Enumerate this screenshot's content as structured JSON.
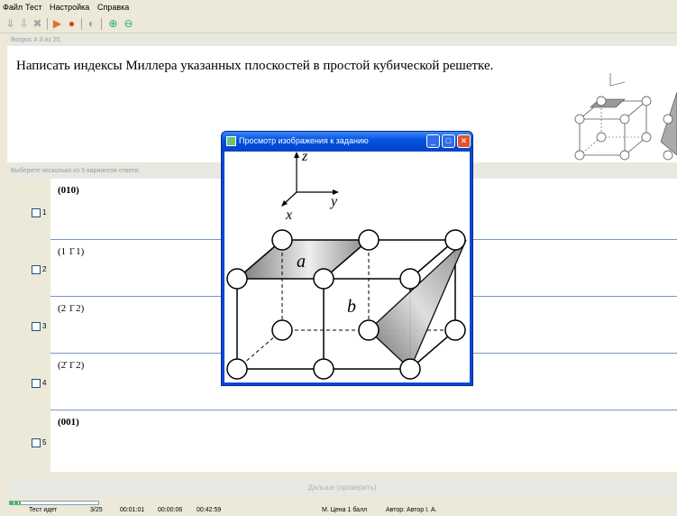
{
  "menu": [
    "Файл",
    "Тест",
    "Настройка",
    "Справка"
  ],
  "toolbar": {
    "icons": [
      "page-down-icon",
      "arrow-down-icon",
      "delete-icon",
      "play-icon",
      "stop-icon",
      "refresh-icon",
      "zoom-in-icon",
      "zoom-out-icon"
    ]
  },
  "question": {
    "header": "Вопрос # 3 из 25:",
    "text": "Написать индексы Миллера указанных плоскостей в простой кубической решетке."
  },
  "answers": {
    "header": "Выберите несколько из 5 вариантов ответа:",
    "options": [
      {
        "num": "1",
        "label": "(010)",
        "checked": false
      },
      {
        "num": "2",
        "label": "(1 1̄ 1)",
        "checked": false
      },
      {
        "num": "3",
        "label": "(2 1̄ 2)",
        "checked": false
      },
      {
        "num": "4",
        "label": "(2̄ 1̄ 2)",
        "checked": false
      },
      {
        "num": "5",
        "label": "(001)",
        "checked": false
      }
    ]
  },
  "next_button": "Дальше (проверить)",
  "progress": {
    "fraction": 0.12
  },
  "status": [
    "Тест идет",
    "3/25",
    "00:01:01",
    "00:00:06",
    "00:42:59",
    "М. Цена 1 балл",
    "Автор: Автор I. А."
  ],
  "popup": {
    "title": "Просмотр изображения к заданию",
    "buttons": {
      "minimize": "_",
      "maximize": "□",
      "close": "✕"
    }
  },
  "figure": {
    "axis_z": "z",
    "axis_y": "y",
    "axis_x": "x",
    "plane_a": "a",
    "plane_b": "b"
  },
  "colors": {
    "accent": "#0a47d6",
    "row_border": "#7a96c8",
    "title_gradient_top": "#3d8bf5"
  }
}
